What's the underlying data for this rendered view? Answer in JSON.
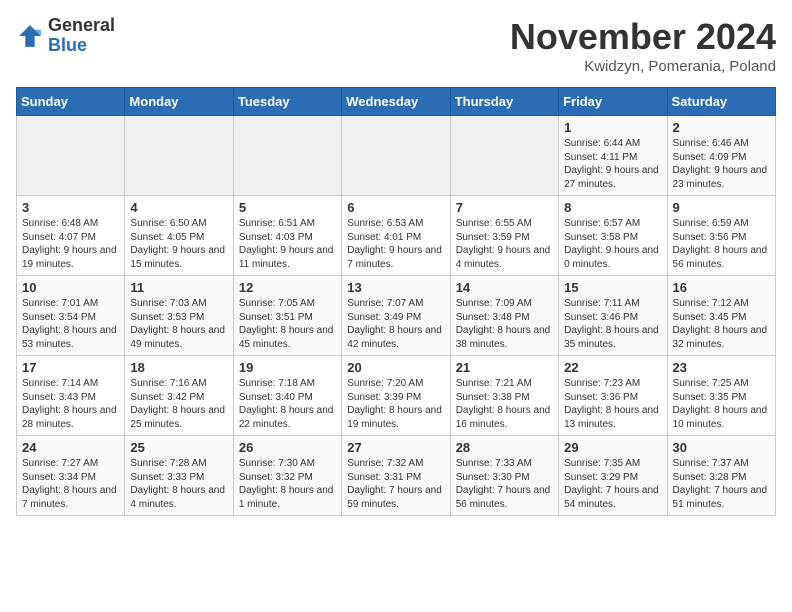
{
  "header": {
    "logo_general": "General",
    "logo_blue": "Blue",
    "month_title": "November 2024",
    "location": "Kwidzyn, Pomerania, Poland"
  },
  "days_of_week": [
    "Sunday",
    "Monday",
    "Tuesday",
    "Wednesday",
    "Thursday",
    "Friday",
    "Saturday"
  ],
  "weeks": [
    [
      {
        "day": "",
        "info": ""
      },
      {
        "day": "",
        "info": ""
      },
      {
        "day": "",
        "info": ""
      },
      {
        "day": "",
        "info": ""
      },
      {
        "day": "",
        "info": ""
      },
      {
        "day": "1",
        "info": "Sunrise: 6:44 AM\nSunset: 4:11 PM\nDaylight: 9 hours and 27 minutes."
      },
      {
        "day": "2",
        "info": "Sunrise: 6:46 AM\nSunset: 4:09 PM\nDaylight: 9 hours and 23 minutes."
      }
    ],
    [
      {
        "day": "3",
        "info": "Sunrise: 6:48 AM\nSunset: 4:07 PM\nDaylight: 9 hours and 19 minutes."
      },
      {
        "day": "4",
        "info": "Sunrise: 6:50 AM\nSunset: 4:05 PM\nDaylight: 9 hours and 15 minutes."
      },
      {
        "day": "5",
        "info": "Sunrise: 6:51 AM\nSunset: 4:03 PM\nDaylight: 9 hours and 11 minutes."
      },
      {
        "day": "6",
        "info": "Sunrise: 6:53 AM\nSunset: 4:01 PM\nDaylight: 9 hours and 7 minutes."
      },
      {
        "day": "7",
        "info": "Sunrise: 6:55 AM\nSunset: 3:59 PM\nDaylight: 9 hours and 4 minutes."
      },
      {
        "day": "8",
        "info": "Sunrise: 6:57 AM\nSunset: 3:58 PM\nDaylight: 9 hours and 0 minutes."
      },
      {
        "day": "9",
        "info": "Sunrise: 6:59 AM\nSunset: 3:56 PM\nDaylight: 8 hours and 56 minutes."
      }
    ],
    [
      {
        "day": "10",
        "info": "Sunrise: 7:01 AM\nSunset: 3:54 PM\nDaylight: 8 hours and 53 minutes."
      },
      {
        "day": "11",
        "info": "Sunrise: 7:03 AM\nSunset: 3:53 PM\nDaylight: 8 hours and 49 minutes."
      },
      {
        "day": "12",
        "info": "Sunrise: 7:05 AM\nSunset: 3:51 PM\nDaylight: 8 hours and 45 minutes."
      },
      {
        "day": "13",
        "info": "Sunrise: 7:07 AM\nSunset: 3:49 PM\nDaylight: 8 hours and 42 minutes."
      },
      {
        "day": "14",
        "info": "Sunrise: 7:09 AM\nSunset: 3:48 PM\nDaylight: 8 hours and 38 minutes."
      },
      {
        "day": "15",
        "info": "Sunrise: 7:11 AM\nSunset: 3:46 PM\nDaylight: 8 hours and 35 minutes."
      },
      {
        "day": "16",
        "info": "Sunrise: 7:12 AM\nSunset: 3:45 PM\nDaylight: 8 hours and 32 minutes."
      }
    ],
    [
      {
        "day": "17",
        "info": "Sunrise: 7:14 AM\nSunset: 3:43 PM\nDaylight: 8 hours and 28 minutes."
      },
      {
        "day": "18",
        "info": "Sunrise: 7:16 AM\nSunset: 3:42 PM\nDaylight: 8 hours and 25 minutes."
      },
      {
        "day": "19",
        "info": "Sunrise: 7:18 AM\nSunset: 3:40 PM\nDaylight: 8 hours and 22 minutes."
      },
      {
        "day": "20",
        "info": "Sunrise: 7:20 AM\nSunset: 3:39 PM\nDaylight: 8 hours and 19 minutes."
      },
      {
        "day": "21",
        "info": "Sunrise: 7:21 AM\nSunset: 3:38 PM\nDaylight: 8 hours and 16 minutes."
      },
      {
        "day": "22",
        "info": "Sunrise: 7:23 AM\nSunset: 3:36 PM\nDaylight: 8 hours and 13 minutes."
      },
      {
        "day": "23",
        "info": "Sunrise: 7:25 AM\nSunset: 3:35 PM\nDaylight: 8 hours and 10 minutes."
      }
    ],
    [
      {
        "day": "24",
        "info": "Sunrise: 7:27 AM\nSunset: 3:34 PM\nDaylight: 8 hours and 7 minutes."
      },
      {
        "day": "25",
        "info": "Sunrise: 7:28 AM\nSunset: 3:33 PM\nDaylight: 8 hours and 4 minutes."
      },
      {
        "day": "26",
        "info": "Sunrise: 7:30 AM\nSunset: 3:32 PM\nDaylight: 8 hours and 1 minute."
      },
      {
        "day": "27",
        "info": "Sunrise: 7:32 AM\nSunset: 3:31 PM\nDaylight: 7 hours and 59 minutes."
      },
      {
        "day": "28",
        "info": "Sunrise: 7:33 AM\nSunset: 3:30 PM\nDaylight: 7 hours and 56 minutes."
      },
      {
        "day": "29",
        "info": "Sunrise: 7:35 AM\nSunset: 3:29 PM\nDaylight: 7 hours and 54 minutes."
      },
      {
        "day": "30",
        "info": "Sunrise: 7:37 AM\nSunset: 3:28 PM\nDaylight: 7 hours and 51 minutes."
      }
    ]
  ]
}
